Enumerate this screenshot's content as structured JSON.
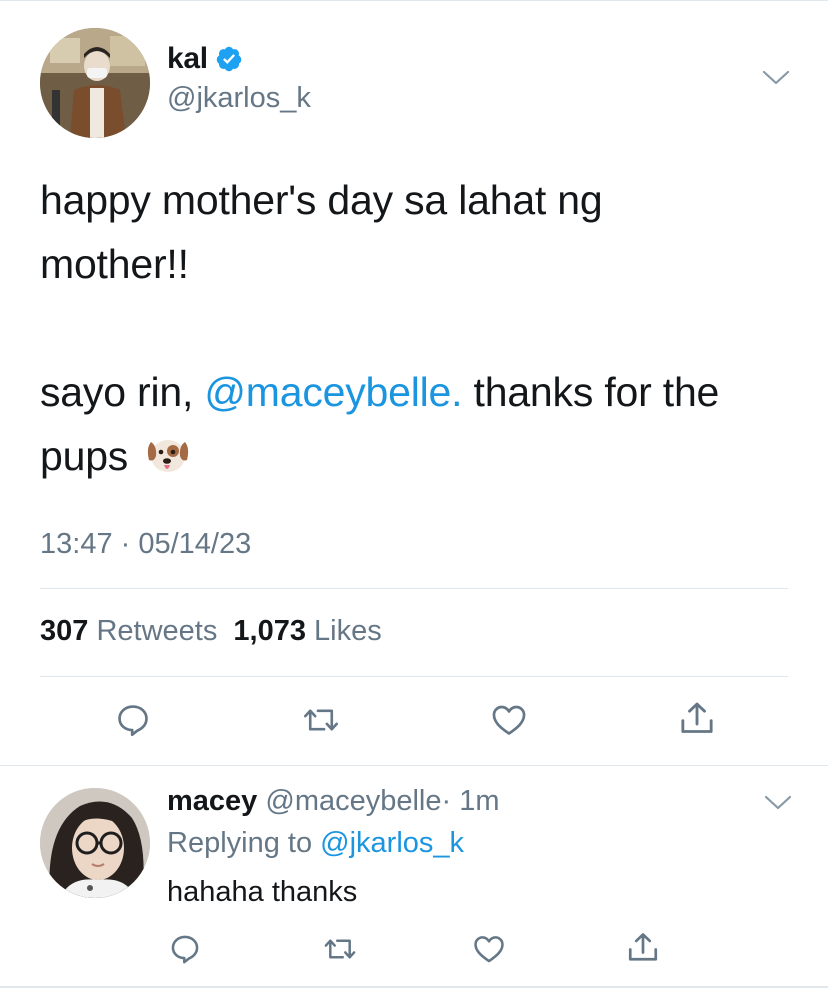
{
  "main_tweet": {
    "display_name": "kal",
    "handle": "@jkarlos_k",
    "verified": true,
    "text_line1": "happy mother's day sa lahat ng mother!!",
    "text_p2_before": "sayo rin, ",
    "text_p2_mention": "@maceybelle.",
    "text_p2_after": " thanks for the pups",
    "emoji": "dog-face-icon",
    "timestamp": "13:47 · 05/14/23",
    "retweets_count": "307",
    "retweets_label": "Retweets",
    "likes_count": "1,073",
    "likes_label": "Likes"
  },
  "reply": {
    "display_name": "macey",
    "handle": "@maceybelle",
    "time": "· 1m",
    "replying_prefix": "Replying to",
    "replying_to": "@jkarlos_k",
    "text": "hahaha thanks"
  },
  "icons": [
    "reply-icon",
    "retweet-icon",
    "like-icon",
    "share-icon",
    "chevron-down-icon",
    "verified-badge-icon"
  ],
  "colors": {
    "link": "#1b95e0",
    "secondary_text": "#657786",
    "primary_text": "#14171a",
    "divider": "#e1e8ed",
    "verified": "#1da1f2"
  }
}
